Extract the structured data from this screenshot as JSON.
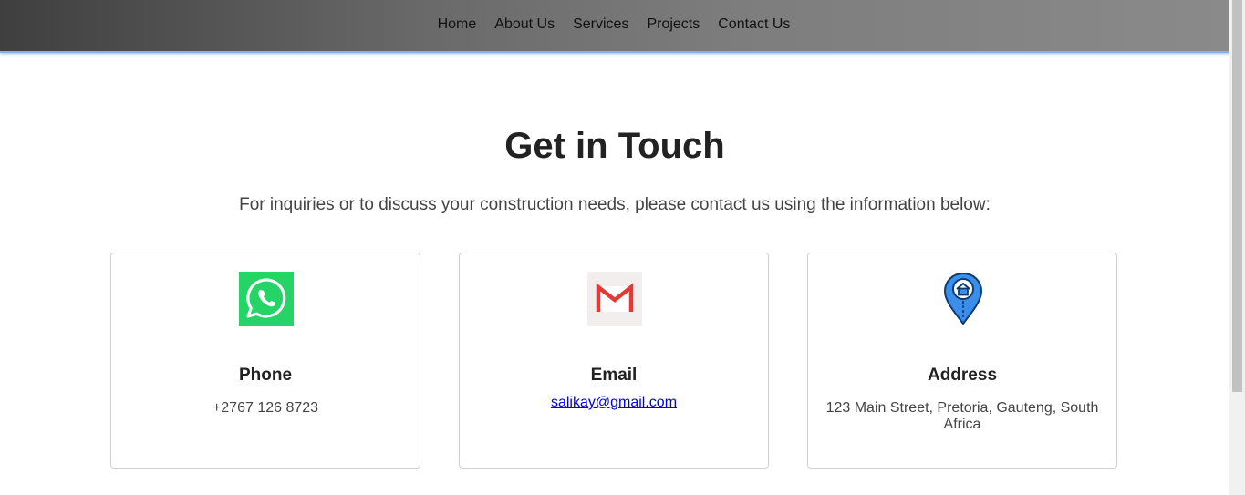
{
  "nav": {
    "items": [
      "Home",
      "About Us",
      "Services",
      "Projects",
      "Contact Us"
    ]
  },
  "contact": {
    "title": "Get in Touch",
    "subtitle": "For inquiries or to discuss your construction needs, please contact us using the information below:",
    "cards": [
      {
        "icon": "whatsapp-icon",
        "label": "Phone",
        "value": "+2767 126 8723"
      },
      {
        "icon": "gmail-icon",
        "label": "Email",
        "value": "salikay@gmail.com"
      },
      {
        "icon": "location-pin-icon",
        "label": "Address",
        "value": "123 Main Street, Pretoria, Gauteng, South Africa"
      }
    ]
  },
  "colors": {
    "whatsapp": "#25d366",
    "gmail_red": "#e53935",
    "pin_blue": "#3b8eea",
    "link": "#0000ee"
  }
}
